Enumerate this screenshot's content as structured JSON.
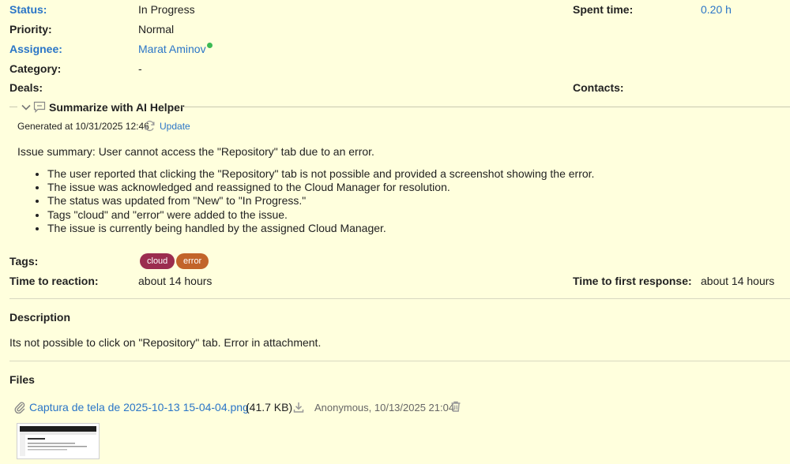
{
  "attributes": {
    "status_label": "Status:",
    "status_value": "In Progress",
    "priority_label": "Priority:",
    "priority_value": "Normal",
    "assignee_label": "Assignee:",
    "assignee_value": "Marat Aminov",
    "category_label": "Category:",
    "category_value": "-",
    "deals_label": "Deals:",
    "spent_time_label": "Spent time:",
    "spent_time_value": "0.20 h",
    "contacts_label": "Contacts:"
  },
  "ai_helper": {
    "title": "Summarize with AI Helper",
    "generated_at": "Generated at 10/31/2025 12:46",
    "update_label": "Update",
    "summary": "Issue summary: User cannot access the \"Repository\" tab due to an error.",
    "bullets": [
      "The user reported that clicking the \"Repository\" tab is not possible and provided a screenshot showing the error.",
      "The issue was acknowledged and reassigned to the Cloud Manager for resolution.",
      "The status was updated from \"New\" to \"In Progress.\"",
      "Tags \"cloud\" and \"error\" were added to the issue.",
      "The issue is currently being handled by the assigned Cloud Manager."
    ]
  },
  "tags": {
    "label": "Tags:",
    "items": [
      {
        "text": "cloud",
        "color": "#9b2d4f"
      },
      {
        "text": "error",
        "color": "#c2642a"
      }
    ]
  },
  "timing": {
    "reaction_label": "Time to reaction:",
    "reaction_value": "about 14 hours",
    "first_response_label": "Time to first response:",
    "first_response_value": "about 14 hours"
  },
  "description": {
    "heading": "Description",
    "text": "Its not possible to click on \"Repository\" tab. Error in attachment."
  },
  "files": {
    "heading": "Files",
    "file_name": "Captura de tela de 2025-10-13 15-04-04.png",
    "file_size": "(41.7 KB)",
    "meta": "Anonymous, 10/13/2025 21:04"
  },
  "colors": {
    "background": "#ffffdd",
    "link": "#2a75c7",
    "online": "#3cba54"
  }
}
